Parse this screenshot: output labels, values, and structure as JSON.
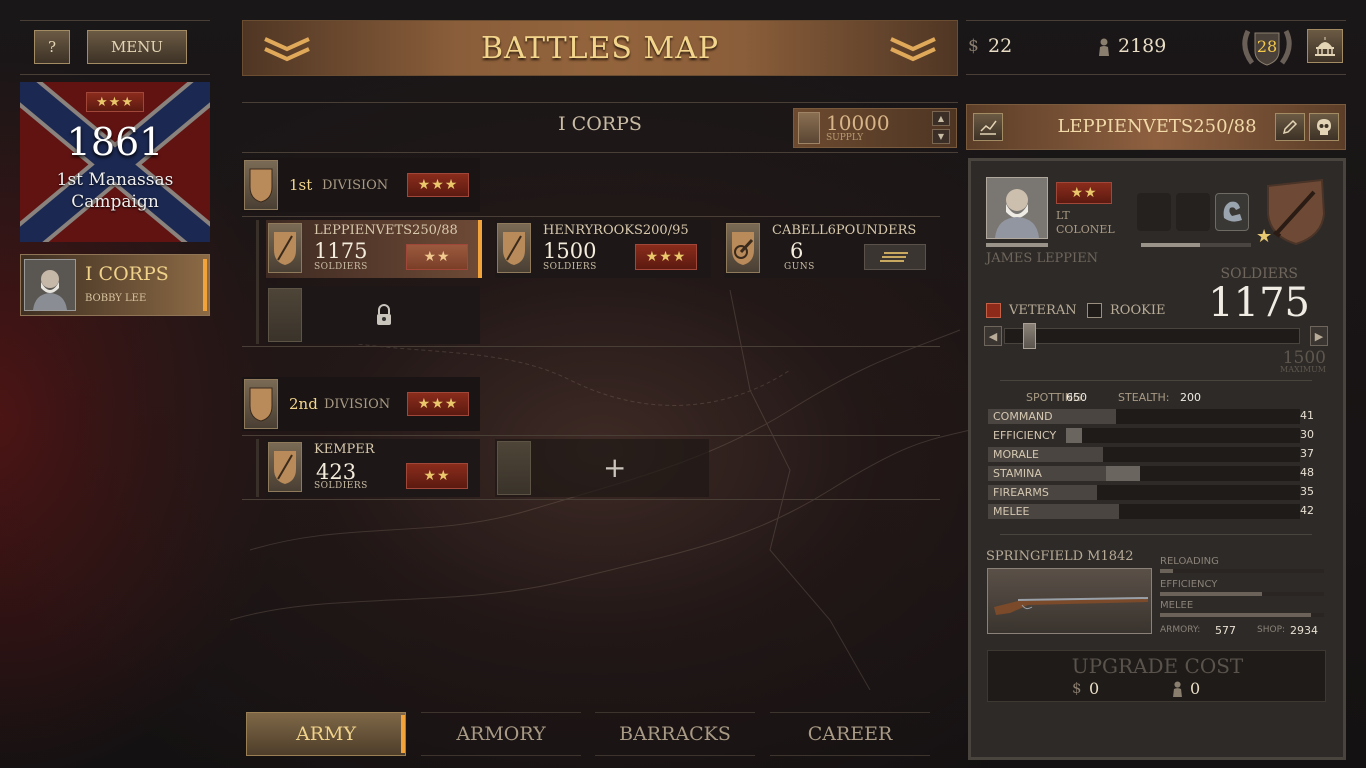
{
  "top_left": {
    "help_label": "?",
    "menu_label": "MENU"
  },
  "campaign": {
    "stars": "★★★",
    "year": "1861",
    "name_line1": "1st Manassas",
    "name_line2": "Campaign"
  },
  "corps_card": {
    "name": "I CORPS",
    "commander": "BOBBY LEE"
  },
  "title": "BATTLES MAP",
  "corps_header": {
    "name": "I CORPS",
    "supply_value": "10000",
    "supply_label": "SUPPLY"
  },
  "divisions": [
    {
      "number": "1st",
      "label": "DIVISION",
      "stars": "★★★",
      "units": [
        {
          "name": "LEPPIENVETS250/88",
          "count": "1175",
          "kind": "SOLDIERS",
          "stars": "★★"
        },
        {
          "name": "HENRYROOKS200/95",
          "count": "1500",
          "kind": "SOLDIERS",
          "stars": "★★★"
        },
        {
          "name": "CABELL6POUNDERS",
          "count": "6",
          "kind": "GUNS",
          "stars": ""
        }
      ]
    },
    {
      "number": "2nd",
      "label": "DIVISION",
      "stars": "★★★",
      "units": [
        {
          "name": "KEMPER",
          "count": "423",
          "kind": "SOLDIERS",
          "stars": "★★"
        }
      ]
    }
  ],
  "add_slot_symbol": "+",
  "tabs": [
    "ARMY",
    "ARMORY",
    "BARRACKS",
    "CAREER"
  ],
  "resources": {
    "money_symbol": "$",
    "money": "22",
    "recruits": "2189",
    "rank_level": "28"
  },
  "unit_panel": {
    "name": "LEPPIENVETS250/88",
    "rank_stars": "★★",
    "rank_line1": "LT",
    "rank_line2": "COLONEL",
    "officer_name": "JAMES LEPPIEN",
    "soldiers_label": "SOLDIERS",
    "soldiers": "1175",
    "veteran_label": "VETERAN",
    "rookie_label": "ROOKIE",
    "maximum": "1500",
    "maximum_label": "MAXIMUM",
    "slider_fraction": 0.06,
    "spotting_label": "SPOTTING:",
    "spotting": "650",
    "stealth_label": "STEALTH:",
    "stealth": "200",
    "stats": [
      {
        "label": "COMMAND",
        "value": "41"
      },
      {
        "label": "EFFICIENCY",
        "value": "30"
      },
      {
        "label": "MORALE",
        "value": "37"
      },
      {
        "label": "STAMINA",
        "value": "48"
      },
      {
        "label": "FIREARMS",
        "value": "35"
      },
      {
        "label": "MELEE",
        "value": "42"
      }
    ],
    "weapon": {
      "name": "SPRINGFIELD M1842",
      "reloading_label": "RELOADING",
      "efficiency_label": "EFFICIENCY",
      "melee_label": "MELEE",
      "reloading": 0.08,
      "efficiency": 0.62,
      "melee": 0.92,
      "armory_label": "ARMORY:",
      "armory": "577",
      "shop_label": "SHOP:",
      "shop": "2934"
    },
    "upgrade": {
      "label": "UPGRADE COST",
      "money": "0",
      "recruits": "0"
    }
  }
}
